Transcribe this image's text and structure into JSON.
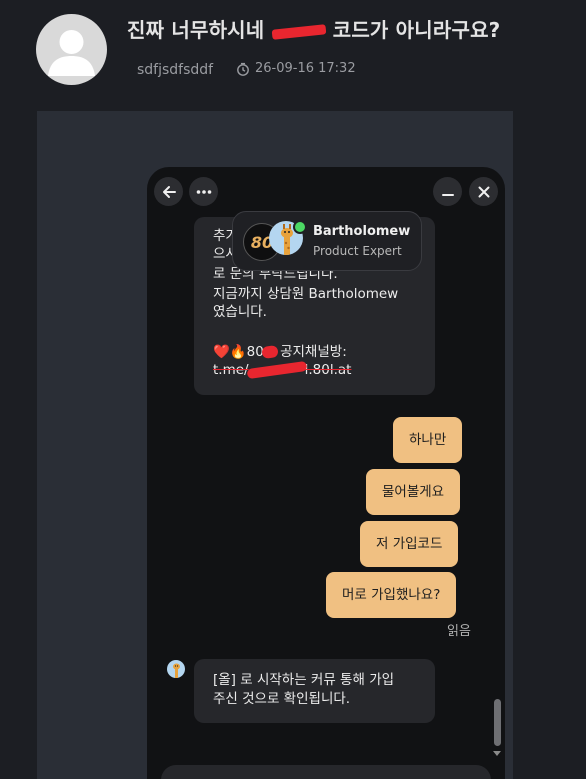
{
  "post": {
    "title_before": "진짜 너무하시네",
    "title_after": "코드가 아니라구요?",
    "author": "sdfjsdfsddf",
    "timestamp": "26-09-16 17:32",
    "time_icon": "clock-icon",
    "avatar_icon": "user-silhouette-icon"
  },
  "chat": {
    "top_buttons": [
      "back-arrow-icon",
      "more-options-icon",
      "minimize-icon",
      "close-icon"
    ],
    "agent": {
      "level_badge": "80",
      "name": "Bartholomew",
      "role": "Product Expert",
      "avatar_icon": "giraffe-icon",
      "status": "online"
    },
    "agent_message_lines": [
      "추가",
      "으시",
      "로 문의 부탁드립니다.",
      "지금까지 상담원 Bartholomew",
      "였습니다.",
      "",
      "❤️🔥80",
      "공지채널방:",
      "t.me/",
      "l.80l.at"
    ],
    "user_messages": [
      "하나만",
      "물어볼게요",
      "저 가입코드",
      "머로 가입했나요?"
    ],
    "read_label": "읽음",
    "agent_reply_lines": [
      "[올] 로 시작하는 커뮤 통해 가입",
      "주신 것으로 확인됩니다."
    ],
    "colors": {
      "user_bubble": "#f0c082",
      "agent_bubble": "#26272b",
      "background": "#111214",
      "redaction": "#e8262f",
      "online": "#4cd964"
    }
  }
}
